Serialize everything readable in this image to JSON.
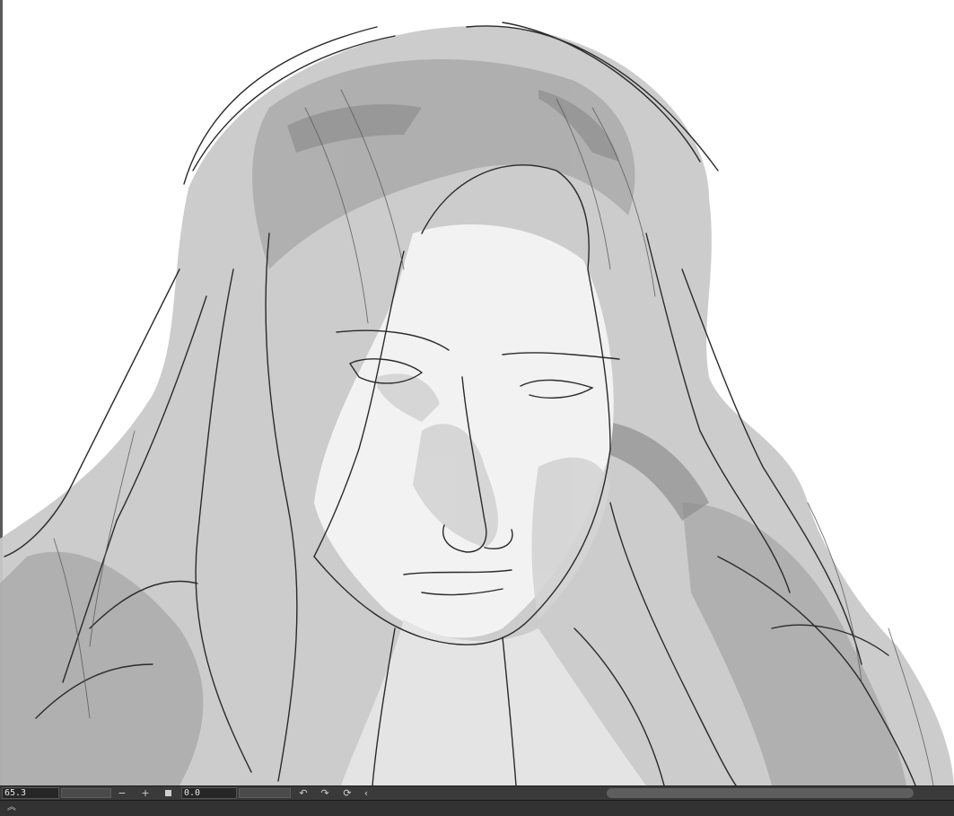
{
  "canvas": {
    "artwork": "pencil sketch of a long-haired man looking down"
  },
  "statusbar": {
    "zoom_value": "65.3",
    "zoom_out_label": "−",
    "zoom_in_label": "+",
    "fit_icon": "square-icon",
    "rotation_value": "0.0",
    "rotate_left_icon": "rotate-ccw-icon",
    "rotate_right_icon": "rotate-cw-icon",
    "reset_rotation_icon": "reset-rotation-icon",
    "flip_icon": "chevron-left-icon"
  },
  "bottombar": {
    "collapse_icon": "double-chevron-up-icon"
  },
  "colors": {
    "statusbar_bg": "#3a3a3a",
    "canvas_bg": "#ffffff",
    "field_bg": "#262626"
  }
}
